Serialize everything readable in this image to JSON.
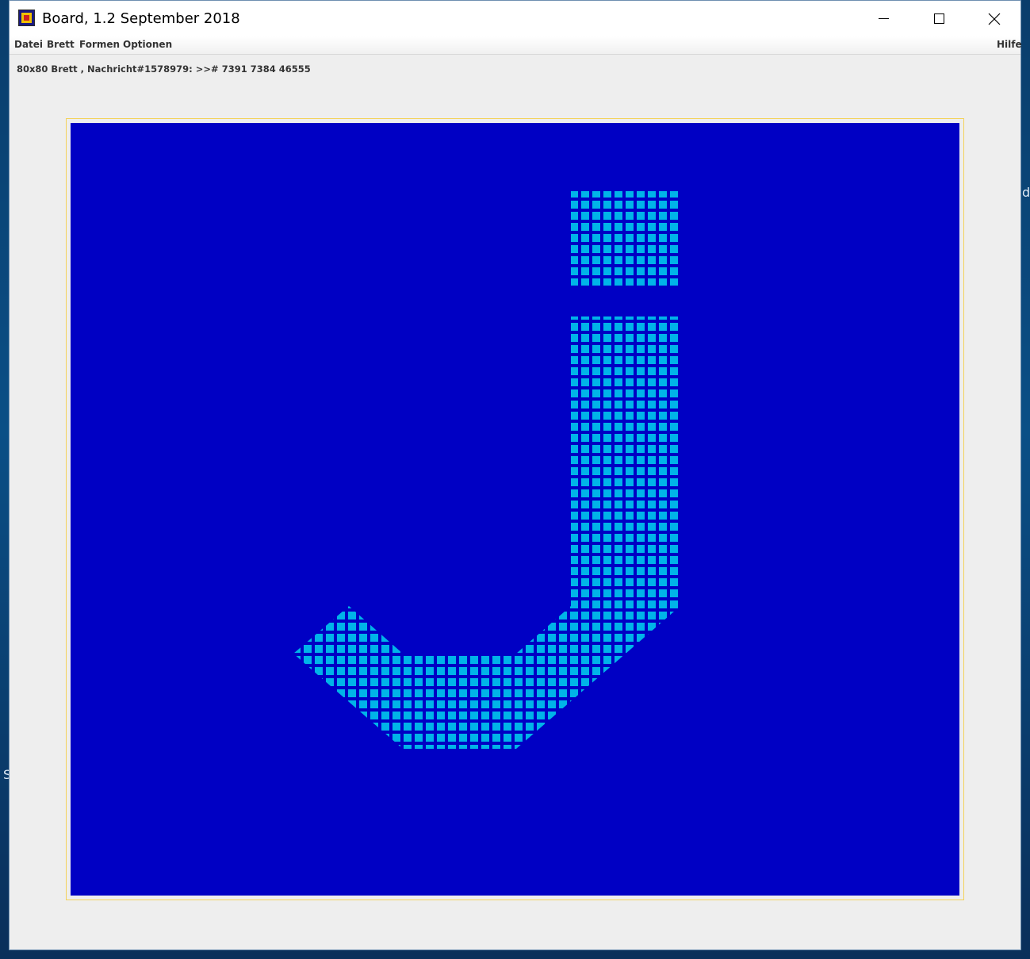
{
  "window": {
    "title": "Board, 1.2 September 2018",
    "controls": {
      "minimize_icon": "minimize-icon",
      "maximize_icon": "maximize-icon",
      "close_icon": "close-icon"
    }
  },
  "menu": {
    "items": [
      "Datei",
      "Brett",
      "Formen",
      "Optionen"
    ],
    "help": "Hilfe"
  },
  "status": {
    "text": "80x80 Brett , Nachricht#1578979: >># 7391 7384 46555"
  },
  "desktop": {
    "fragment_top": "d",
    "fragment_bottom": "S"
  },
  "board": {
    "background_color": "#0000c4",
    "cell_color": "#00b4e8",
    "shape": "J"
  }
}
